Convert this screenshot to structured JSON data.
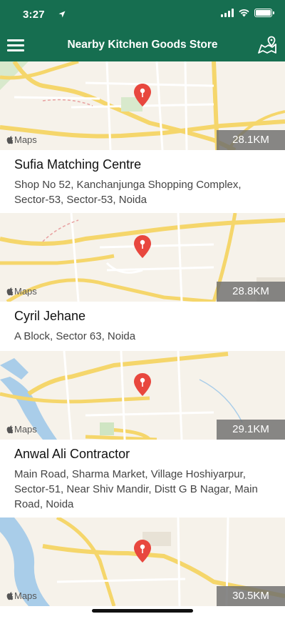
{
  "status_bar": {
    "time": "3:27"
  },
  "nav": {
    "title": "Nearby Kitchen Goods Store"
  },
  "maps_brand": "Maps",
  "stores": [
    {
      "name": "Sufia Matching Centre",
      "address": "Shop No 52, Kanchanjunga Shopping Complex, Sector-53, Sector-53, Noida",
      "distance": "28.1KM"
    },
    {
      "name": "Cyril Jehane",
      "address": "A Block, Sector 63, Noida",
      "distance": "28.8KM"
    },
    {
      "name": "Anwal Ali Contractor",
      "address": "Main Road, Sharma Market, Village Hoshiyarpur, Sector-51, Near Shiv Mandir, Distt G B Nagar, Main Road, Noida",
      "distance": "29.1KM"
    },
    {
      "name": "",
      "address": "",
      "distance": "30.5KM"
    }
  ],
  "colors": {
    "header": "#166e50",
    "pin": "#e8473e",
    "road_major": "#f5d66b",
    "water": "#a9cde9",
    "park": "#cfe5c3"
  },
  "icons": {
    "menu": "hamburger-icon",
    "map": "map-pin-icon",
    "location": "location-arrow-icon"
  }
}
